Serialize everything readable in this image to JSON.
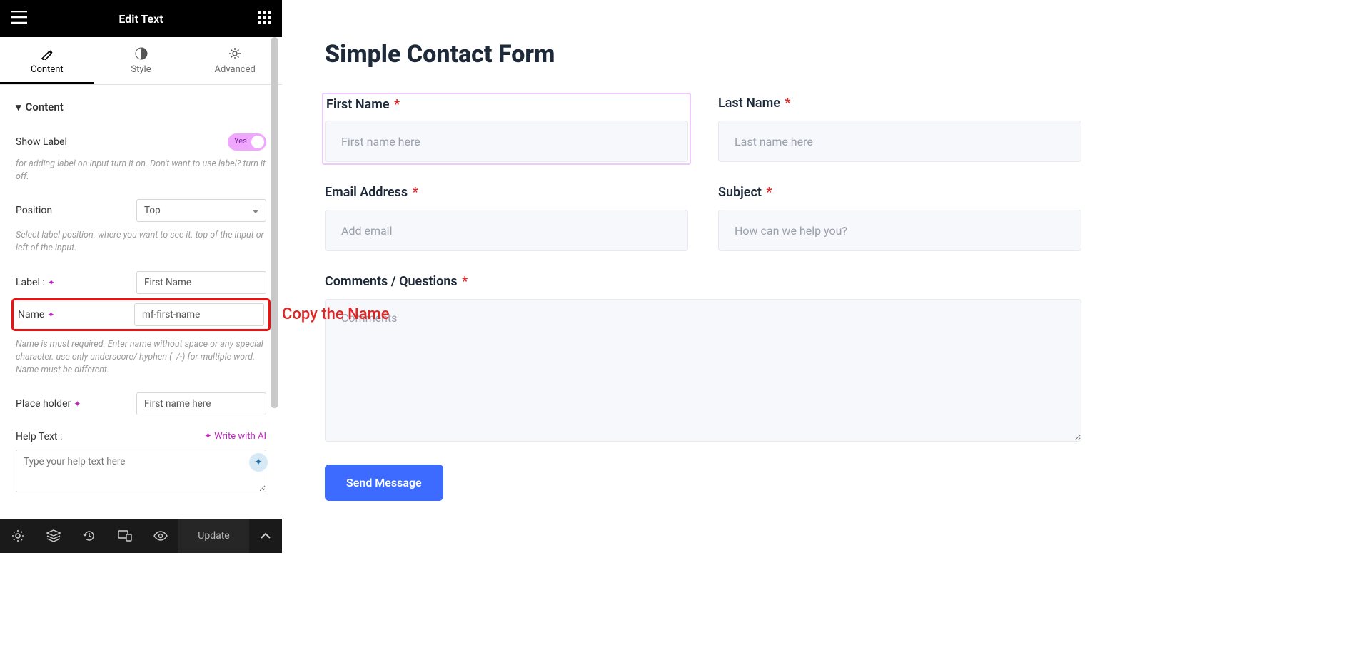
{
  "panel": {
    "title": "Edit Text",
    "tabs": {
      "content": "Content",
      "style": "Style",
      "advanced": "Advanced"
    },
    "section": "Content",
    "showLabel": {
      "label": "Show Label",
      "value": "Yes",
      "help": "for adding label on input turn it on. Don't want to use label? turn it off."
    },
    "position": {
      "label": "Position",
      "value": "Top",
      "help": "Select label position. where you want to see it. top of the input or left of the input."
    },
    "labelField": {
      "label": "Label :",
      "value": "First Name"
    },
    "nameField": {
      "label": "Name",
      "value": "mf-first-name",
      "help": "Name is must required. Enter name without space or any special character. use only underscore/ hyphen (_/-) for multiple word. Name must be different."
    },
    "placeholder": {
      "label": "Place holder",
      "value": "First name here"
    },
    "helpText": {
      "label": "Help Text :",
      "ai": "Write with AI",
      "placeholder": "Type your help text here"
    },
    "footer": {
      "update": "Update"
    }
  },
  "annotation": "Copy the Name",
  "form": {
    "title": "Simple Contact Form",
    "fields": {
      "first": {
        "label": "First Name",
        "placeholder": "First name here"
      },
      "last": {
        "label": "Last Name",
        "placeholder": "Last name here"
      },
      "email": {
        "label": "Email Address",
        "placeholder": "Add email"
      },
      "subject": {
        "label": "Subject",
        "placeholder": "How can we help you?"
      },
      "comments": {
        "label": "Comments / Questions",
        "placeholder": "Comments"
      }
    },
    "submit": "Send Message"
  }
}
